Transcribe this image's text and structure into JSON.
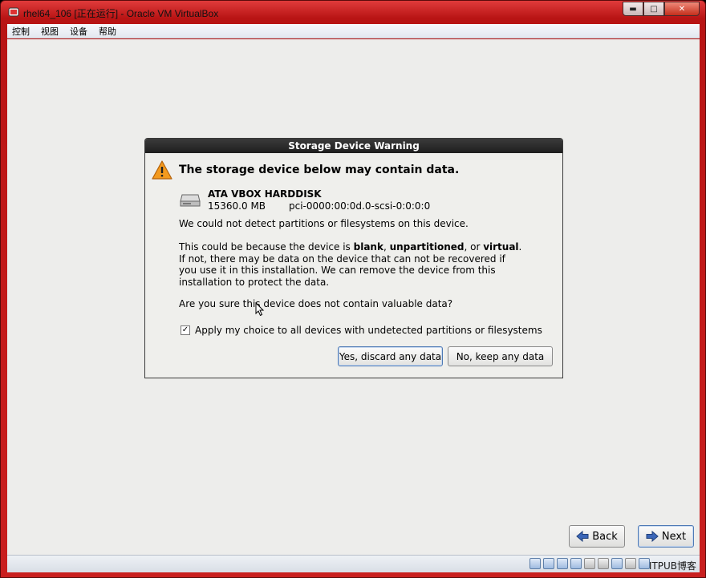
{
  "window": {
    "title": "rhel64_106 [正在运行] - Oracle VM VirtualBox",
    "controls": {
      "minimize": "▬",
      "maximize": "□",
      "close": "✕"
    }
  },
  "menubar": {
    "items": [
      {
        "label": "控制"
      },
      {
        "label": "视图"
      },
      {
        "label": "设备"
      },
      {
        "label": "帮助"
      }
    ]
  },
  "dialog": {
    "title": "Storage Device Warning",
    "heading": "The storage device below may contain data.",
    "device": {
      "name": "ATA VBOX HARDDISK",
      "size": "15360.0 MB",
      "path": "pci-0000:00:0d.0-scsi-0:0:0:0"
    },
    "message_1": "We could not detect partitions or filesystems on this device.",
    "message_2": {
      "prefix": "This could be because the device is ",
      "blank": "blank",
      "sep1": ", ",
      "unpartitioned": "unpartitioned",
      "sep2": ", or ",
      "virtual": "virtual",
      "suffix": ". If not, there may be data on the device that can not be recovered if you use it in this installation. We can remove the device from this installation to protect the data."
    },
    "question": "Are you sure this device does not contain valuable data?",
    "apply_checkbox": {
      "checked": true,
      "mark": "✓",
      "label": "Apply my choice to all devices with undetected partitions or filesystems"
    },
    "buttons": {
      "yes": "Yes, discard any data",
      "no": "No, keep any data"
    }
  },
  "installer_nav": {
    "back": "Back",
    "next": "Next"
  },
  "statusbar": {
    "watermark": "ITPUB博客"
  },
  "colors": {
    "frame_red": "#c41b1b",
    "dialog_title_bg": "#2a2a2a",
    "guest_bg": "#ededeb",
    "default_button_border": "#4f7ab5"
  }
}
